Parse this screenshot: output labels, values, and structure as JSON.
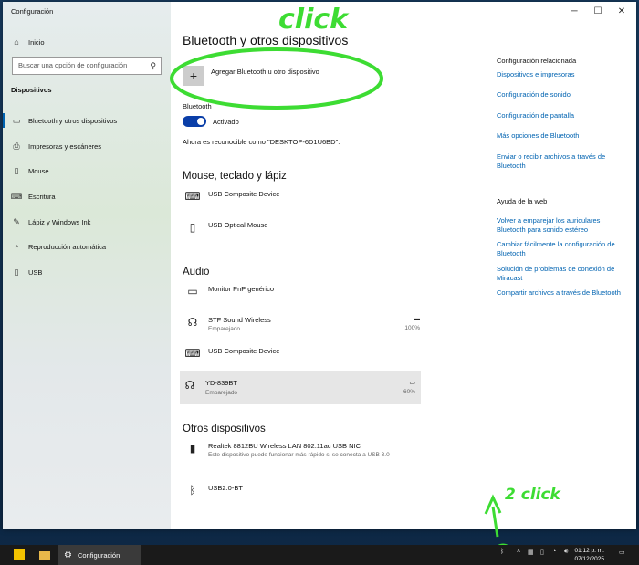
{
  "window": {
    "title": "Configuración"
  },
  "sidebar": {
    "home_label": "Inicio",
    "search_placeholder": "Buscar una opción de configuración",
    "section": "Dispositivos",
    "items": [
      {
        "label": "Bluetooth y otros dispositivos",
        "icon": "bluetooth-devices-icon"
      },
      {
        "label": "Impresoras y escáneres",
        "icon": "printer-icon"
      },
      {
        "label": "Mouse",
        "icon": "mouse-icon"
      },
      {
        "label": "Escritura",
        "icon": "keyboard-icon"
      },
      {
        "label": "Lápiz y Windows Ink",
        "icon": "pen-icon"
      },
      {
        "label": "Reproducción automática",
        "icon": "autoplay-icon"
      },
      {
        "label": "USB",
        "icon": "usb-icon"
      }
    ]
  },
  "main": {
    "title": "Bluetooth y otros dispositivos",
    "add_label": "Agregar Bluetooth u otro dispositivo",
    "bluetooth_label": "Bluetooth",
    "toggle_state": "Activado",
    "discoverable": "Ahora es reconocible como \"DESKTOP-6D1U6BD\".",
    "sections": {
      "input": "Mouse, teclado y lápiz",
      "audio": "Audio",
      "other": "Otros dispositivos"
    },
    "input_devices": [
      {
        "name": "USB Composite Device"
      },
      {
        "name": "USB Optical Mouse"
      }
    ],
    "audio_devices": [
      {
        "name": "Monitor PnP genérico"
      },
      {
        "name": "STF Sound Wireless",
        "status": "Emparejado",
        "battery": "100%"
      },
      {
        "name": "USB Composite Device"
      },
      {
        "name": "YD-839BT",
        "status": "Emparejado",
        "battery": "60%"
      }
    ],
    "other_devices": [
      {
        "name": "Realtek 8812BU Wireless LAN 802.11ac USB NIC",
        "status": "Este dispositivo puede funcionar más rápido si se conecta a USB 3.0"
      },
      {
        "name": "USB2.0-BT"
      }
    ]
  },
  "related": {
    "title": "Configuración relacionada",
    "links": [
      "Dispositivos e impresoras",
      "Configuración de sonido",
      "Configuración de pantalla",
      "Más opciones de Bluetooth",
      "Enviar o recibir archivos a través de Bluetooth"
    ],
    "help_title": "Ayuda de la web",
    "help_links": [
      "Volver a emparejar los auriculares Bluetooth para sonido estéreo",
      "Cambiar fácilmente la configuración de Bluetooth",
      "Solución de problemas de conexión de Miracast",
      "Compartir archivos a través de Bluetooth"
    ]
  },
  "annotations": {
    "click1": "click",
    "click2": "2 click"
  },
  "taskbar": {
    "app_label": "Configuración",
    "time": "01:12 p. m.",
    "date": "07/12/2025"
  }
}
